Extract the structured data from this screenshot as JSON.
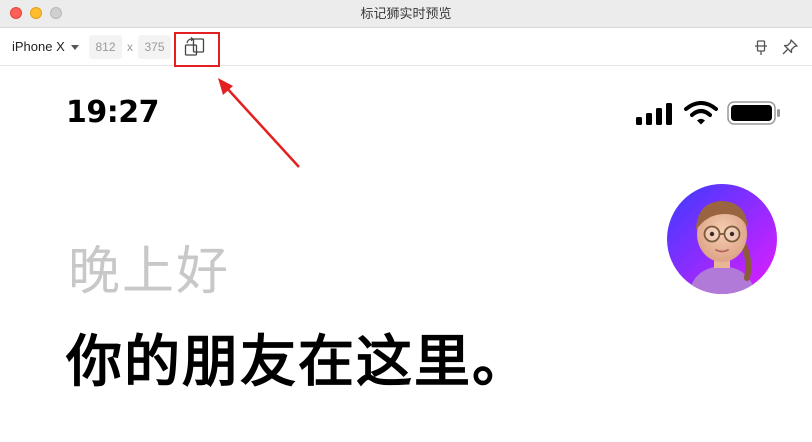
{
  "window": {
    "title": "标记狮实时预览"
  },
  "toolbar": {
    "device": "iPhone X",
    "width": "812",
    "separator": "x",
    "height": "375",
    "rotate_icon": "rotate-icon",
    "layout_icon": "pin-horizontal-icon",
    "pin_icon": "pin-icon"
  },
  "status_bar": {
    "time": "19:27",
    "signal_icon": "cellular-signal-icon",
    "wifi_icon": "wifi-icon",
    "battery_icon": "battery-icon"
  },
  "content": {
    "greeting": "晚上好",
    "headline": "你的朋友在这里。"
  },
  "colors": {
    "highlight": "#e32020",
    "greeting": "#c8c8c8",
    "headline": "#000000",
    "avatar_gradient_start": "#3b3bff",
    "avatar_gradient_end": "#e21dff"
  }
}
